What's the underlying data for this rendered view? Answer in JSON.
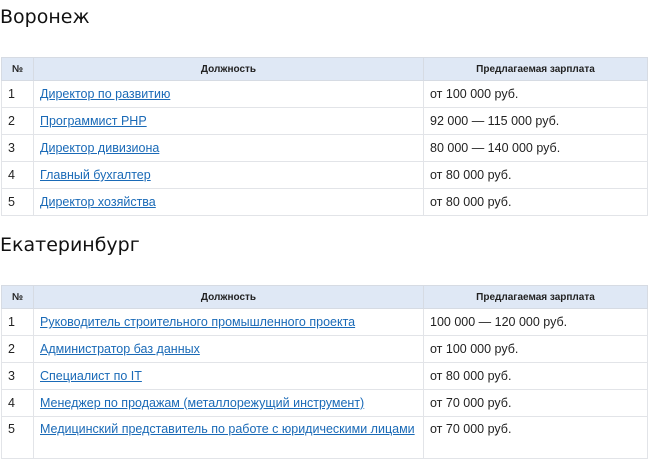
{
  "sections": [
    {
      "city": "Воронеж",
      "headers": {
        "num": "№",
        "position": "Должность",
        "salary": "Предлагаемая зарплата"
      },
      "rows": [
        {
          "num": "1",
          "position": "Директор по развитию",
          "salary": "от 100 000 руб."
        },
        {
          "num": "2",
          "position": "Программист PHP",
          "salary": "92 000 — 115 000 руб."
        },
        {
          "num": "3",
          "position": "Директор дивизиона",
          "salary": "80 000 — 140 000 руб."
        },
        {
          "num": "4",
          "position": "Главный бухгалтер",
          "salary": "от 80 000 руб."
        },
        {
          "num": "5",
          "position": "Директор хозяйства",
          "salary": "от 80 000 руб."
        }
      ]
    },
    {
      "city": "Екатеринбург",
      "headers": {
        "num": "№",
        "position": "Должность",
        "salary": "Предлагаемая зарплата"
      },
      "rows": [
        {
          "num": "1",
          "position": "Руководитель строительного промышленного проекта",
          "salary": "100 000 — 120 000 руб."
        },
        {
          "num": "2",
          "position": "Администратор баз данных",
          "salary": "от 100 000 руб."
        },
        {
          "num": "3",
          "position": "Специалист по IT",
          "salary": "от 80 000 руб."
        },
        {
          "num": "4",
          "position": "Менеджер по продажам (металлорежущий инструмент)",
          "salary": "от 70 000 руб."
        },
        {
          "num": "5",
          "position": "Медицинский представитель по работе с юридическими лицами",
          "salary": "от 70 000 руб."
        }
      ]
    }
  ]
}
